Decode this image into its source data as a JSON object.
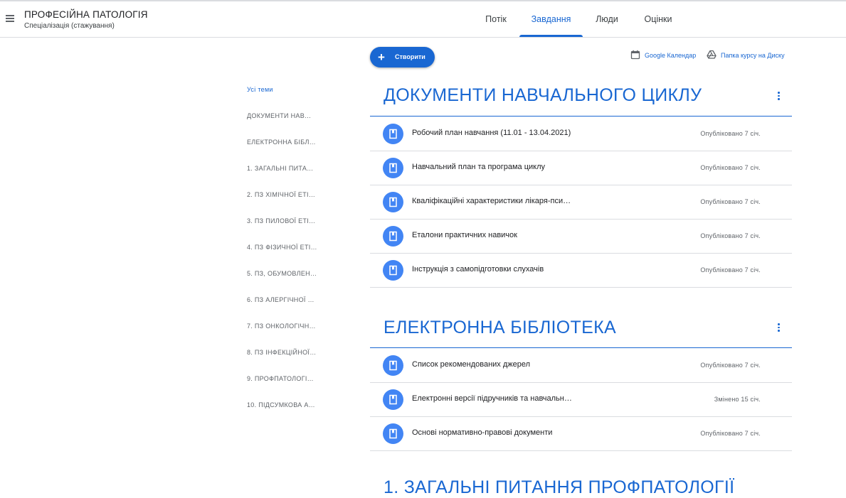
{
  "header": {
    "title": "ПРОФЕСІЙНА ПАТОЛОГІЯ",
    "subtitle": "Спеціалізація (стажування)",
    "tabs": [
      {
        "label": "Потік"
      },
      {
        "label": "Завдання",
        "active": true
      },
      {
        "label": "Люди"
      },
      {
        "label": "Оцінки"
      }
    ]
  },
  "toolbar": {
    "create_label": "Створити",
    "calendar_label": "Google Календар",
    "drive_label": "Папка курсу на Диску"
  },
  "topics": [
    "Усі теми",
    "ДОКУМЕНТИ НАВ…",
    "ЕЛЕКТРОННА БІБЛ…",
    "1. ЗАГАЛЬНІ ПИТА…",
    "2. ПЗ ХІМІЧНОЇ ЕТІ…",
    "3. ПЗ ПИЛОВОЇ ЕТІ…",
    "4. ПЗ ФІЗИЧНОЇ ЕТІ…",
    "5. ПЗ, ОБУМОВЛЕН…",
    "6. ПЗ АЛЕРГІЧНОЇ …",
    "7. ПЗ ОНКОЛОГІЧН…",
    "8. ПЗ ІНФЕКЦІЙНОЇ…",
    "9. ПРОФПАТОЛОГІ…",
    "10. ПІДСУМКОВА А…"
  ],
  "sections": [
    {
      "title": "ДОКУМЕНТИ НАВЧАЛЬНОГО ЦИКЛУ",
      "items": [
        {
          "title": "Робочий план навчання (11.01 - 13.04.2021)",
          "date": "Опубліковано 7 січ."
        },
        {
          "title": "Навчальний план та програма циклу",
          "date": "Опубліковано 7 січ."
        },
        {
          "title": "Кваліфікаційні характеристики лікаря-пси…",
          "date": "Опубліковано 7 січ."
        },
        {
          "title": "Еталони практичних навичок",
          "date": "Опубліковано 7 січ."
        },
        {
          "title": "Інструкція з самопідготовки слухачів",
          "date": "Опубліковано 7 січ."
        }
      ]
    },
    {
      "title": "ЕЛЕКТРОННА БІБЛІОТЕКА",
      "items": [
        {
          "title": "Список рекомендованих джерел",
          "date": "Опубліковано 7 січ."
        },
        {
          "title": "Електронні версії підручників та навчальн…",
          "date": "Змінено 15 січ."
        },
        {
          "title": "Основі нормативно-правові документи",
          "date": "Опубліковано 7 січ."
        }
      ]
    },
    {
      "title": "1. ЗАГАЛЬНІ ПИТАННЯ ПРОФПАТОЛОГІЇ"
    }
  ],
  "icons": {
    "menu": "menu-icon",
    "add": "plus-icon",
    "calendar": "calendar-icon",
    "drive": "drive-icon",
    "material": "material-icon",
    "more": "more-vert-icon"
  },
  "colors": {
    "accent": "#1967d2",
    "icon_bg": "#4285f4",
    "divider": "#dadce0"
  }
}
